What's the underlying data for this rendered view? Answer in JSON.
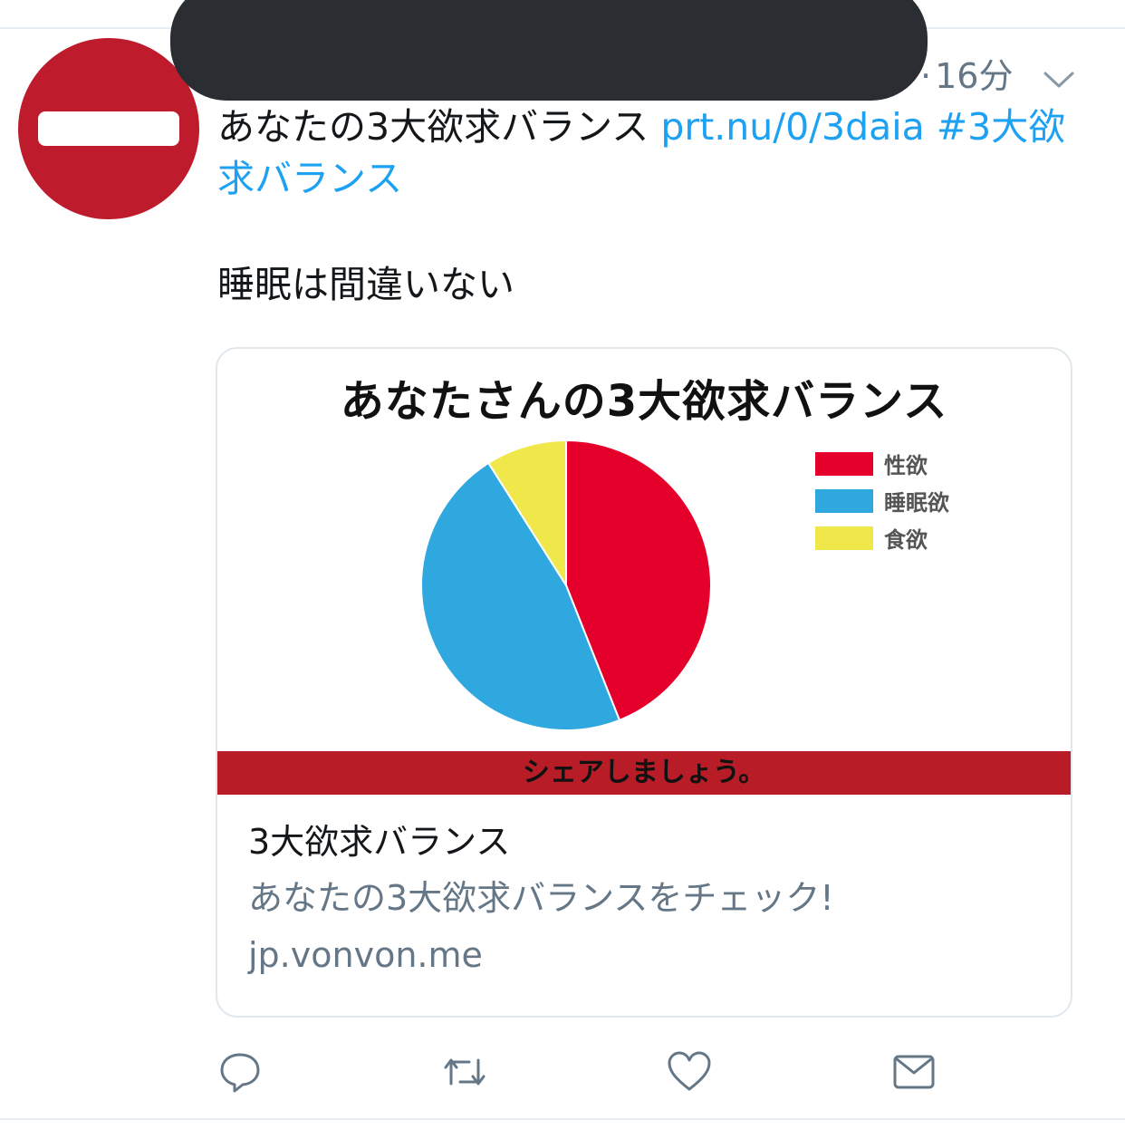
{
  "tweet": {
    "time": "16分",
    "text_plain": "あなたの3大欲求バランス ",
    "text_link": "prt.nu/0/3daia #3大欲求バランス",
    "note": "睡眠は間違いない"
  },
  "card": {
    "image_title": "あなたさんの3大欲求バランス",
    "banner": "シェアしましょう。",
    "title": "3大欲求バランス",
    "description": "あなたの3大欲求バランスをチェック!",
    "domain": "jp.vonvon.me"
  },
  "chart_data": {
    "type": "pie",
    "title": "あなたさんの3大欲求バランス",
    "categories": [
      "性欲",
      "睡眠欲",
      "食欲"
    ],
    "values": [
      44,
      47,
      9
    ],
    "colors": [
      "#e4002b",
      "#2ea8df",
      "#f0e84a"
    ],
    "start_angle_deg": 0,
    "legend_position": "top-right"
  },
  "colors": {
    "link": "#1da1f2",
    "secondary_text": "#657786",
    "avatar_red": "#be1b2c",
    "banner_red": "#b81c26"
  },
  "icons": {
    "avatar": "no-entry-sign-icon",
    "reply": "reply-icon",
    "retweet": "retweet-icon",
    "like": "heart-icon",
    "dm": "envelope-icon",
    "menu": "chevron-down-icon"
  }
}
